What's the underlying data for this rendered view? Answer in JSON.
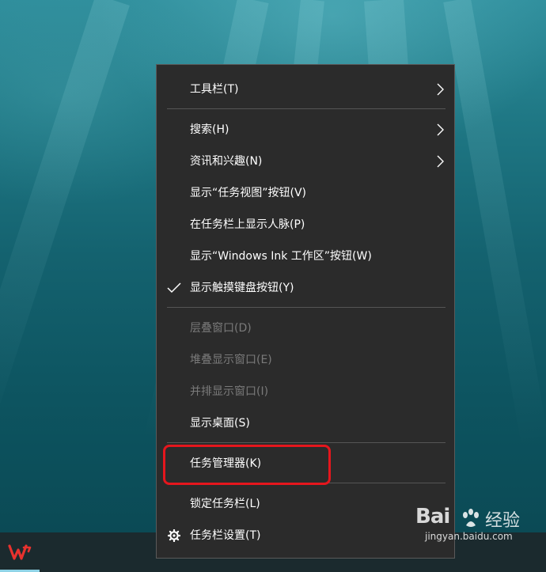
{
  "context_menu": {
    "items": [
      {
        "label": "工具栏(T)",
        "submenu": true
      },
      {
        "label": "搜索(H)",
        "submenu": true
      },
      {
        "label": "资讯和兴趣(N)",
        "submenu": true
      },
      {
        "label": "显示“任务视图”按钮(V)"
      },
      {
        "label": "在任务栏上显示人脉(P)"
      },
      {
        "label": "显示“Windows Ink 工作区”按钮(W)"
      },
      {
        "label": "显示触摸键盘按钮(Y)",
        "checked": true
      },
      {
        "label": "层叠窗口(D)",
        "disabled": true
      },
      {
        "label": "堆叠显示窗口(E)",
        "disabled": true
      },
      {
        "label": "并排显示窗口(I)",
        "disabled": true
      },
      {
        "label": "显示桌面(S)"
      },
      {
        "label": "任务管理器(K)",
        "highlighted": true
      },
      {
        "label": "锁定任务栏(L)"
      },
      {
        "label": "任务栏设置(T)",
        "icon": "gear-icon"
      }
    ]
  },
  "taskbar": {
    "app_icon": "wps-logo-icon"
  },
  "watermark": {
    "brand": "Bai",
    "brand_cn": "经验",
    "url": "jingyan.baidu.com"
  },
  "colors": {
    "menu_bg": "#2b2b2b",
    "highlight": "#e5161d",
    "disabled_text": "#7a7a7a"
  }
}
